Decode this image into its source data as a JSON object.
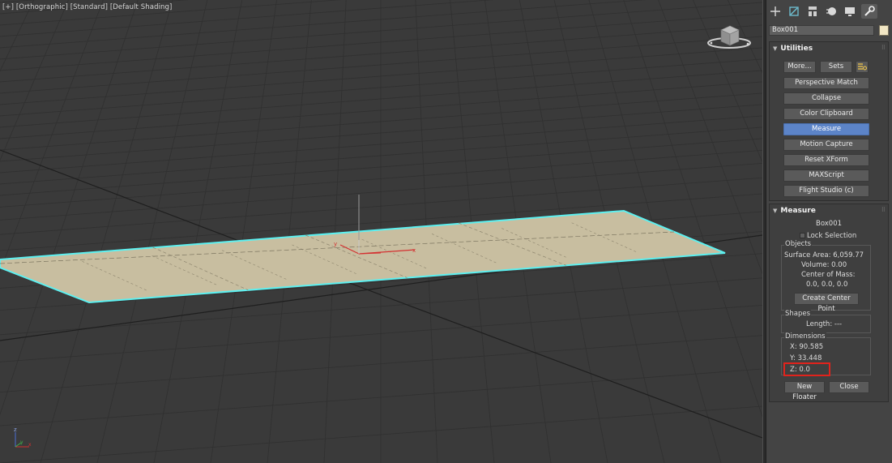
{
  "viewport": {
    "label": "[+] [Orthographic] [Standard] [Default Shading]",
    "gizmo": {
      "x_label": "x",
      "y_label": "y"
    },
    "axis_tripod": {
      "x": "x",
      "y": "y",
      "z": "z"
    }
  },
  "command_panel": {
    "tabs": [
      {
        "name": "create",
        "icon": "plus-icon"
      },
      {
        "name": "modify",
        "icon": "modify-icon"
      },
      {
        "name": "hierarchy",
        "icon": "hierarchy-icon"
      },
      {
        "name": "motion",
        "icon": "motion-icon"
      },
      {
        "name": "display",
        "icon": "display-icon"
      },
      {
        "name": "utilities",
        "icon": "wrench-icon"
      }
    ],
    "active_tab": "utilities",
    "object_name": "Box001",
    "object_color": "#f1e6c4"
  },
  "utilities": {
    "title": "Utilities",
    "more_label": "More...",
    "sets_label": "Sets",
    "buttons": [
      "Perspective Match",
      "Collapse",
      "Color Clipboard",
      "Measure",
      "Motion Capture",
      "Reset XForm",
      "MAXScript",
      "Flight Studio (c)"
    ],
    "active_button": "Measure"
  },
  "measure": {
    "title": "Measure",
    "object_name": "Box001",
    "lock_selection_label": "Lock Selection",
    "lock_selection_checked": false,
    "objects_group_label": "Objects",
    "surface_area": "Surface Area: 6,059.77",
    "volume": "Volume: 0.00",
    "center_of_mass_label": "Center of Mass:",
    "center_of_mass_value": "0.0, 0.0, 0.0",
    "create_center_point_label": "Create Center Point",
    "shapes_group_label": "Shapes",
    "length": "Length: ---",
    "dimensions_group_label": "Dimensions",
    "x": "X:  90.585",
    "y": "Y:  33.448",
    "z": "Z:  0.0",
    "new_floater_label": "New Floater",
    "close_label": "Close"
  },
  "colors": {
    "accent_active": "#5c84c8",
    "selection_outline": "#5cf0f0",
    "plane_fill": "#c8bea0",
    "highlight_box": "#e0231c"
  }
}
